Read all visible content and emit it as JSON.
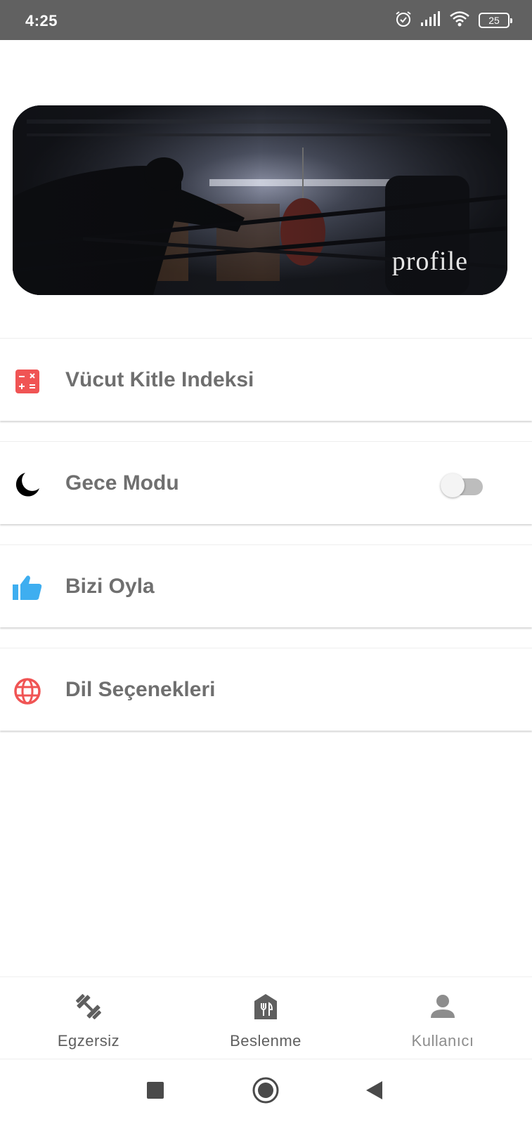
{
  "status_bar": {
    "time": "4:25",
    "battery": "25",
    "icons": [
      "alarm-icon",
      "signal-icon",
      "wifi-icon",
      "battery-icon"
    ]
  },
  "banner": {
    "caption": "profile"
  },
  "menu": {
    "items": [
      {
        "label": "Vücut Kitle Indeksi",
        "icon": "calculator-icon",
        "icon_color": "#f05454"
      },
      {
        "label": "Gece Modu",
        "icon": "moon-icon",
        "icon_color": "#000000",
        "toggle_on": false
      },
      {
        "label": "Bizi Oyla",
        "icon": "thumbs-up-icon",
        "icon_color": "#3eaef0"
      },
      {
        "label": "Dil Seçenekleri",
        "icon": "globe-icon",
        "icon_color": "#f05454"
      }
    ]
  },
  "bottom_nav": {
    "items": [
      {
        "label": "Egzersiz",
        "icon": "dumbbell-icon"
      },
      {
        "label": "Beslenme",
        "icon": "restaurant-icon"
      },
      {
        "label": "Kullanıcı",
        "icon": "person-icon",
        "selected": true
      }
    ]
  },
  "system_nav": [
    "recents-button",
    "home-button",
    "back-button"
  ],
  "colors": {
    "status_bar": "#616161",
    "label_text": "#6f6f6f",
    "nav_text": "#5f5f5f",
    "nav_text_selected": "#8d8d8d",
    "red_accent": "#f05454",
    "blue_accent": "#3eaef0"
  }
}
